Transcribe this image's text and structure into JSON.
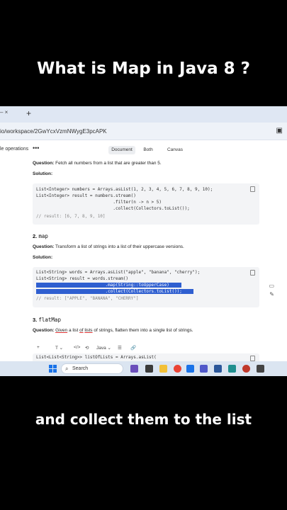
{
  "headline": "What is Map in Java 8 ?",
  "caption": "and collect them to the list",
  "browser": {
    "url": "io/workspace/2GwYcxVzmNWygE3pcAPK",
    "new_tab": "+"
  },
  "toolbar": {
    "title": "le operations",
    "more": "•••",
    "views": [
      "Document",
      "Both",
      "Canvas"
    ],
    "active_view": "Document"
  },
  "document": {
    "q1": {
      "label": "Question:",
      "text": " Fetch all numbers from a list that are greater than 5."
    },
    "solution_label": "Solution:",
    "code1": [
      "List<Integer> numbers = Arrays.asList(1, 2, 3, 4, 5, 6, 7, 8, 9, 10);",
      "List<Integer> result = numbers.stream()",
      "                              .filter(n -> n > 5)",
      "                              .collect(Collectors.toList());",
      "// result: [6, 7, 8, 9, 10]"
    ],
    "s2": {
      "num": "2.",
      "code": "map"
    },
    "q2": {
      "label": "Question:",
      "text": " Transform a list of strings into a list of their uppercase versions."
    },
    "code2": [
      "List<String> words = Arrays.asList(\"apple\", \"banana\", \"cherry\");",
      "List<String> result = words.stream()",
      "                           .map(String::toUpperCase)",
      "                           .collect(Collectors.toList());",
      "// result: [\"APPLE\", \"BANANA\", \"CHERRY\"]"
    ],
    "s3": {
      "num": "3.",
      "code": "flatMap"
    },
    "q3": {
      "label": "Question:",
      "pre": " ",
      "given": "Given",
      "mid": " a list ",
      "of": "of",
      "sp": " ",
      "lists": "lists",
      "post": " of strings, flatten them into a single list of strings."
    },
    "code3_line": "List<List<String>> listOfLists = Arrays.asList("
  },
  "format_bar": {
    "items": [
      "+",
      "T ⌄",
      "</>",
      "⟲",
      "Java ⌄",
      "☰",
      "🔗"
    ]
  },
  "taskbar": {
    "search_placeholder": "Search"
  },
  "colors": {
    "selection": "#2f5fd0",
    "accent": "#1a73e8"
  }
}
